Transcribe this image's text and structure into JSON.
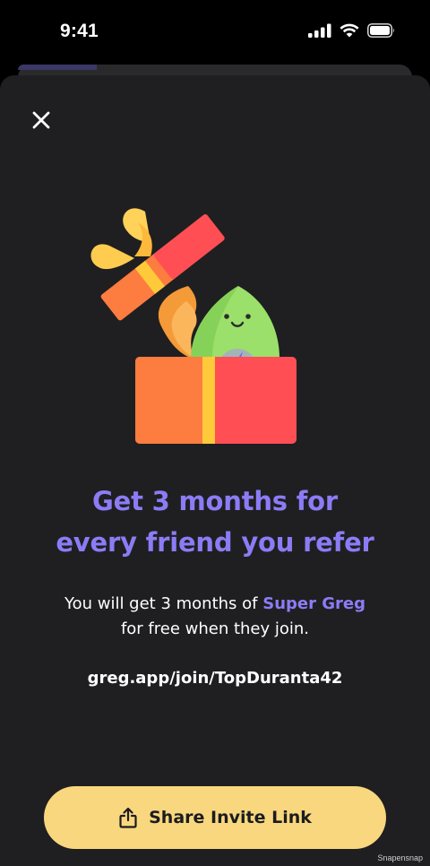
{
  "status_bar": {
    "time": "9:41",
    "icons": [
      "signal-icon",
      "wifi-icon",
      "battery-icon"
    ]
  },
  "sheet": {
    "close_icon": "close-icon",
    "illustration": "gift-box-with-leaf-mascot",
    "headline_line1": "Get 3 months for",
    "headline_line2": "every friend you refer",
    "subtext_part1": "You will get 3 months of ",
    "subtext_highlight": "Super Greg",
    "subtext_line2": "for free when they join.",
    "invite_link": "greg.app/join/TopDuranta42",
    "share_button_label": "Share Invite Link",
    "share_icon": "share-icon"
  },
  "watermark": "Snapensnap",
  "colors": {
    "background": "#1f1f21",
    "accent": "#8b7cf6",
    "button": "#f8d77e"
  }
}
